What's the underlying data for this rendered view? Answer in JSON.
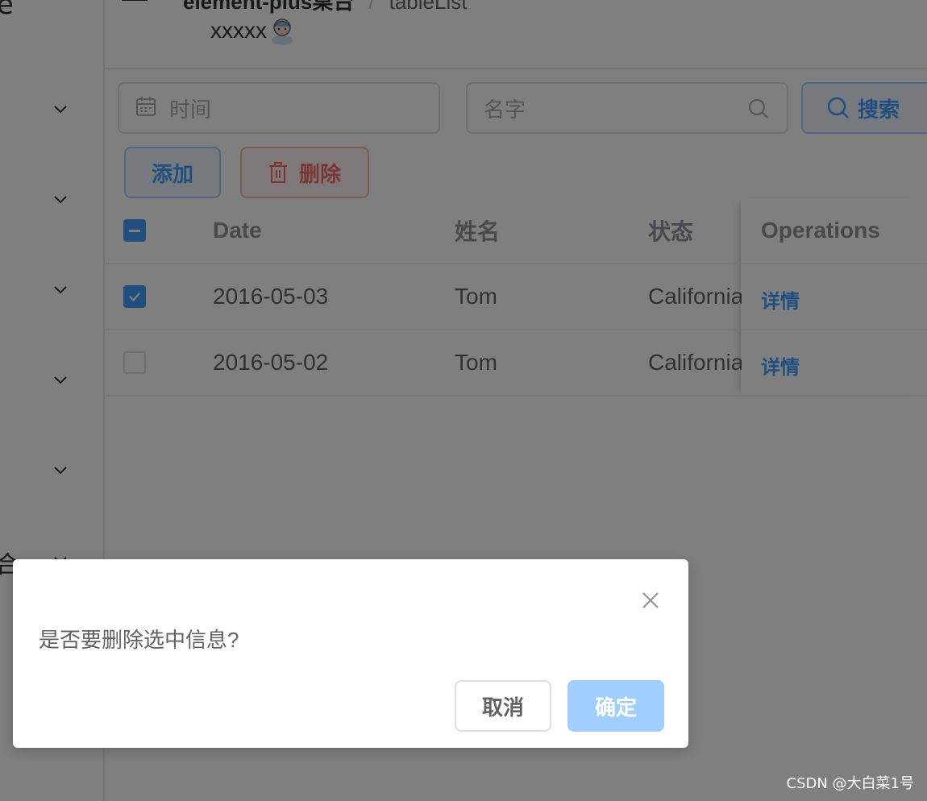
{
  "sidebar": {
    "brand_fragment": "e",
    "menu_fragment": "合"
  },
  "header": {
    "breadcrumb_root": "element-plus桌台",
    "breadcrumb_current": "tableList",
    "username": "xxxxx"
  },
  "toolbar": {
    "date_placeholder": "时间",
    "name_placeholder": "名字",
    "search_label": "搜索",
    "add_label": "添加",
    "delete_label": "删除"
  },
  "table": {
    "columns": [
      "Date",
      "姓名",
      "状态",
      "Operations"
    ],
    "rows": [
      {
        "date": "2016-05-03",
        "name": "Tom",
        "state": "California",
        "op": "详情",
        "checked": true
      },
      {
        "date": "2016-05-02",
        "name": "Tom",
        "state": "California",
        "op": "详情",
        "checked": false
      }
    ]
  },
  "dialog": {
    "message": "是否要删除选中信息?",
    "cancel_label": "取消",
    "confirm_label": "确定"
  },
  "watermark": "CSDN @大白菜1号",
  "colors": {
    "primary": "#409eff",
    "danger": "#f56c6c",
    "mask": "rgba(0,0,0,0.5)"
  }
}
